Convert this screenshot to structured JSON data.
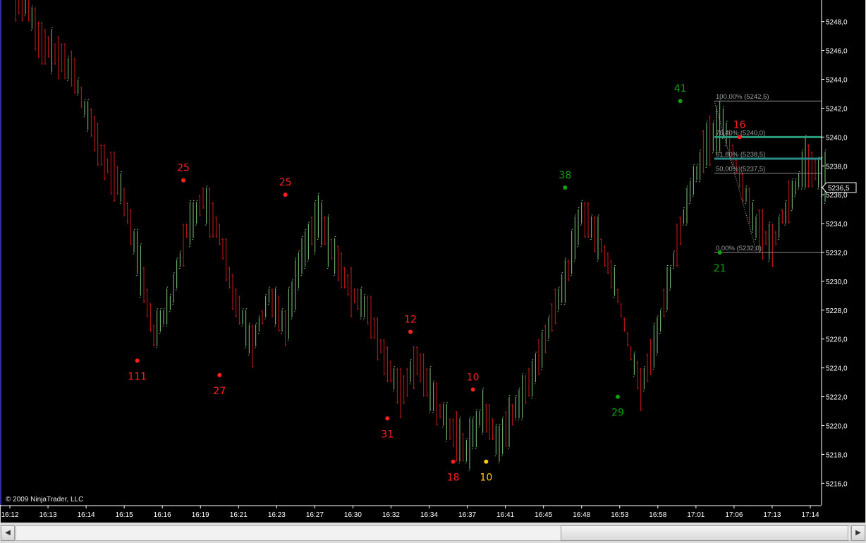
{
  "chart_data": {
    "type": "ohlc",
    "x_ticks": [
      "16:12",
      "16:13",
      "16:14",
      "16:15",
      "16:16",
      "16:19",
      "16:21",
      "16:23",
      "16:27",
      "16:30",
      "16:32",
      "16:34",
      "16:37",
      "16:41",
      "16:45",
      "16:48",
      "16:53",
      "16:58",
      "17:01",
      "17:06",
      "17:13",
      "17:14"
    ],
    "y_ticks": [
      "5216,0",
      "5218,0",
      "5220,0",
      "5222,0",
      "5224,0",
      "5226,0",
      "5228,0",
      "5230,0",
      "5232,0",
      "5234,0",
      "5236,0",
      "5238,0",
      "5240,0",
      "5242,0",
      "5244,0",
      "5246,0",
      "5248,0"
    ],
    "ylim": [
      5214.5,
      5249.5
    ],
    "current_price_label": "5236,5",
    "current_price": 5236.5,
    "swing_labels": [
      {
        "text": "111",
        "bar": 37,
        "price": 5224.5,
        "dir": "low",
        "color": "#ff2020"
      },
      {
        "text": "25",
        "bar": 51,
        "price": 5237.0,
        "dir": "high",
        "color": "#ff2020"
      },
      {
        "text": "27",
        "bar": 62,
        "price": 5223.5,
        "dir": "low",
        "color": "#ff2020"
      },
      {
        "text": "25",
        "bar": 82,
        "price": 5236.0,
        "dir": "high",
        "color": "#ff2020"
      },
      {
        "text": "31",
        "bar": 113,
        "price": 5220.5,
        "dir": "low",
        "color": "#ff2020"
      },
      {
        "text": "12",
        "bar": 120,
        "price": 5226.5,
        "dir": "high",
        "color": "#ff2020"
      },
      {
        "text": "18",
        "bar": 133,
        "price": 5217.5,
        "dir": "low",
        "color": "#ff2020"
      },
      {
        "text": "10",
        "bar": 139,
        "price": 5222.5,
        "dir": "high",
        "color": "#ff2020"
      },
      {
        "text": "10",
        "bar": 143,
        "price": 5217.5,
        "dir": "low",
        "color": "#ffcc00"
      },
      {
        "text": "38",
        "bar": 167,
        "price": 5236.5,
        "dir": "high",
        "color": "#10a010"
      },
      {
        "text": "29",
        "bar": 183,
        "price": 5222.0,
        "dir": "low",
        "color": "#10a010"
      },
      {
        "text": "41",
        "bar": 202,
        "price": 5242.5,
        "dir": "high",
        "color": "#10a010"
      },
      {
        "text": "21",
        "bar": 214,
        "price": 5232.0,
        "dir": "low",
        "color": "#10a010"
      },
      {
        "text": "16",
        "bar": 220,
        "price": 5240.0,
        "dir": "high",
        "color": "#ff2020"
      }
    ],
    "fib_levels": [
      {
        "label": "100,00% (5242,5)",
        "price": 5242.5,
        "color": "#8a8a8a",
        "width": 1
      },
      {
        "label": "76,40% (5240,0)",
        "price": 5240.0,
        "color": "#2a9a7a",
        "width": 3
      },
      {
        "label": "61,80% (5238,5)",
        "price": 5238.5,
        "color": "#2a8a8a",
        "width": 3
      },
      {
        "label": "50,00% (5237,5)",
        "price": 5237.5,
        "color": "#8a8a8a",
        "width": 1
      },
      {
        "label": "0,00% (5232,0)",
        "price": 5232.0,
        "color": "#8a8a8a",
        "width": 1
      }
    ],
    "anchor_points": [
      [
        5249.5,
        5248.5,
        4
      ],
      [
        5247.5,
        5246.0,
        7
      ],
      [
        5246.0,
        5243.5,
        17
      ],
      [
        5243.0,
        5240.0,
        22
      ],
      [
        5240.0,
        5236.5,
        27
      ],
      [
        5238.5,
        5234.5,
        32
      ],
      [
        5233.5,
        5230.5,
        37
      ],
      [
        5228.0,
        5224.5,
        42
      ],
      [
        5230.5,
        5226.5,
        47
      ],
      [
        5234.5,
        5232.5,
        52
      ],
      [
        5237.0,
        5234.5,
        57
      ],
      [
        5235.0,
        5231.5,
        62
      ],
      [
        5230.5,
        5226.5,
        67
      ],
      [
        5227.5,
        5223.5,
        72
      ],
      [
        5230.5,
        5227.5,
        77
      ],
      [
        5228.5,
        5225.0,
        82
      ],
      [
        5234.0,
        5229.5,
        87
      ],
      [
        5236.0,
        5233.0,
        92
      ],
      [
        5234.0,
        5229.5,
        97
      ],
      [
        5231.5,
        5227.0,
        102
      ],
      [
        5229.5,
        5226.5,
        107
      ],
      [
        5226.5,
        5223.0,
        112
      ],
      [
        5224.0,
        5220.5,
        117
      ],
      [
        5226.5,
        5222.5,
        122
      ],
      [
        5224.5,
        5219.5,
        127
      ],
      [
        5221.5,
        5218.0,
        132
      ],
      [
        5219.0,
        5217.5,
        137
      ],
      [
        5222.5,
        5219.5,
        142
      ],
      [
        5220.0,
        5217.5,
        147
      ],
      [
        5223.0,
        5219.5,
        152
      ],
      [
        5225.0,
        5221.5,
        157
      ],
      [
        5228.5,
        5225.0,
        162
      ],
      [
        5232.0,
        5228.0,
        167
      ],
      [
        5236.5,
        5233.0,
        172
      ],
      [
        5235.0,
        5231.0,
        177
      ],
      [
        5231.5,
        5228.5,
        182
      ],
      [
        5227.0,
        5223.0,
        187
      ],
      [
        5223.0,
        5222.0,
        190
      ],
      [
        5228.0,
        5224.5,
        195
      ],
      [
        5233.0,
        5230.0,
        200
      ],
      [
        5238.0,
        5234.5,
        205
      ],
      [
        5241.0,
        5238.0,
        210
      ],
      [
        5242.5,
        5239.5,
        215
      ],
      [
        5239.0,
        5235.5,
        220
      ],
      [
        5235.0,
        5232.5,
        225
      ],
      [
        5233.0,
        5232.0,
        230
      ],
      [
        5237.0,
        5234.0,
        235
      ],
      [
        5240.0,
        5236.5,
        240
      ],
      [
        5239.0,
        5235.5,
        245
      ]
    ],
    "bar_count": 247,
    "colors": {
      "background": "#000000",
      "up": "#7fc97f",
      "down": "#cc1818",
      "axis_text": "#ffffff",
      "grid": "#ffffff"
    }
  },
  "credit_text": "© 2009 NinjaTrader, LLC",
  "scrollbar": {
    "left_icon": "arrow-left-icon",
    "right_icon": "arrow-right-icon"
  }
}
